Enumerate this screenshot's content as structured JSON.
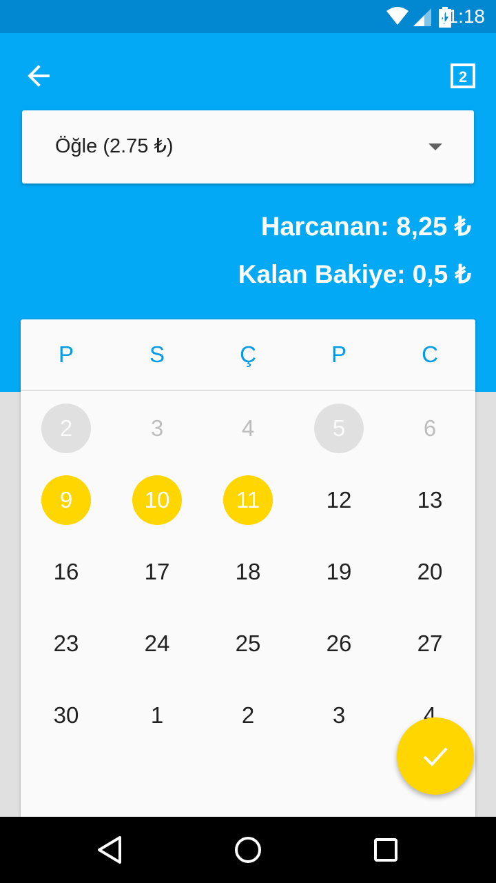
{
  "status_bar": {
    "time": "11:18",
    "icons": [
      "wifi-icon",
      "cell-signal-icon",
      "battery-charging-icon"
    ]
  },
  "toolbar": {
    "back_icon": "arrow-back-icon",
    "calendar_icon": "calendar-day-icon",
    "calendar_icon_number": "2"
  },
  "meal_select": {
    "selected": "Öğle (2.75 ₺)"
  },
  "summary": {
    "spent": "Harcanan: 8,25 ₺",
    "balance": "Kalan Bakiye: 0,5 ₺"
  },
  "calendar": {
    "weekdays": [
      "P",
      "S",
      "Ç",
      "P",
      "C"
    ],
    "weeks": [
      [
        {
          "day": "2",
          "state": "muted-circle"
        },
        {
          "day": "3",
          "state": "muted"
        },
        {
          "day": "4",
          "state": "muted"
        },
        {
          "day": "5",
          "state": "muted-circle"
        },
        {
          "day": "6",
          "state": "muted"
        }
      ],
      [
        {
          "day": "9",
          "state": "selected"
        },
        {
          "day": "10",
          "state": "selected"
        },
        {
          "day": "11",
          "state": "selected"
        },
        {
          "day": "12",
          "state": "normal"
        },
        {
          "day": "13",
          "state": "normal"
        }
      ],
      [
        {
          "day": "16",
          "state": "normal"
        },
        {
          "day": "17",
          "state": "normal"
        },
        {
          "day": "18",
          "state": "normal"
        },
        {
          "day": "19",
          "state": "normal"
        },
        {
          "day": "20",
          "state": "normal"
        }
      ],
      [
        {
          "day": "23",
          "state": "normal"
        },
        {
          "day": "24",
          "state": "normal"
        },
        {
          "day": "25",
          "state": "normal"
        },
        {
          "day": "26",
          "state": "normal"
        },
        {
          "day": "27",
          "state": "normal"
        }
      ],
      [
        {
          "day": "30",
          "state": "normal"
        },
        {
          "day": "1",
          "state": "normal"
        },
        {
          "day": "2",
          "state": "normal"
        },
        {
          "day": "3",
          "state": "normal"
        },
        {
          "day": "4",
          "state": "normal"
        }
      ]
    ]
  },
  "fab": {
    "icon": "check-icon"
  },
  "nav": {
    "icons": [
      "back-triangle-icon",
      "home-circle-icon",
      "recents-square-icon"
    ]
  },
  "colors": {
    "primary": "#03a9f4",
    "primary_dark": "#0288d1",
    "accent": "#ffd600",
    "weekday_text": "#039be5"
  }
}
